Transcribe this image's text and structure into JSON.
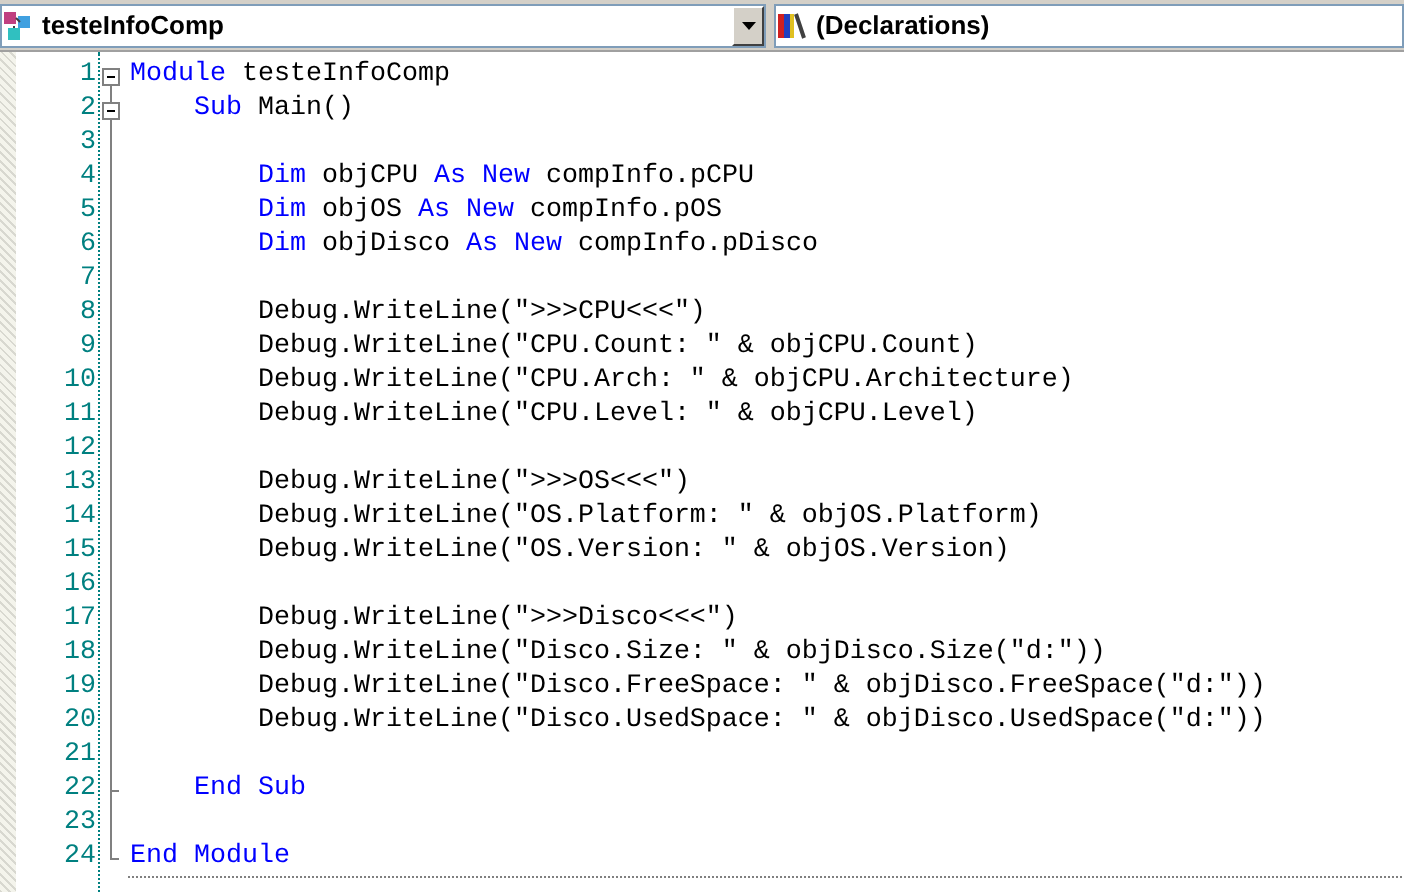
{
  "class_dropdown": {
    "value": "testeInfoComp"
  },
  "method_dropdown": {
    "value": "(Declarations)"
  },
  "editor": {
    "lines": [
      {
        "number": "1",
        "collapsible": true,
        "block_end": false,
        "tokens": [
          {
            "kind": "keyword",
            "text": "Module"
          },
          {
            "kind": "text",
            "text": " testeInfoComp"
          }
        ]
      },
      {
        "number": "2",
        "collapsible": true,
        "block_end": false,
        "tokens": [
          {
            "kind": "keyword",
            "text": "    Sub"
          },
          {
            "kind": "text",
            "text": " Main()"
          }
        ]
      },
      {
        "number": "3",
        "collapsible": false,
        "block_end": false
      },
      {
        "number": "4",
        "collapsible": false,
        "block_end": false,
        "tokens": [
          {
            "kind": "keyword",
            "text": "        Dim"
          },
          {
            "kind": "text",
            "text": " objCPU "
          },
          {
            "kind": "keyword",
            "text": "As New"
          },
          {
            "kind": "text",
            "text": " compInfo.pCPU"
          }
        ]
      },
      {
        "number": "5",
        "collapsible": false,
        "block_end": false,
        "tokens": [
          {
            "kind": "keyword",
            "text": "        Dim"
          },
          {
            "kind": "text",
            "text": " objOS "
          },
          {
            "kind": "keyword",
            "text": "As New"
          },
          {
            "kind": "text",
            "text": " compInfo.pOS"
          }
        ]
      },
      {
        "number": "6",
        "collapsible": false,
        "block_end": false,
        "tokens": [
          {
            "kind": "keyword",
            "text": "        Dim"
          },
          {
            "kind": "text",
            "text": " objDisco "
          },
          {
            "kind": "keyword",
            "text": "As New"
          },
          {
            "kind": "text",
            "text": " compInfo.pDisco"
          }
        ]
      },
      {
        "number": "7",
        "collapsible": false,
        "block_end": false
      },
      {
        "number": "8",
        "collapsible": false,
        "block_end": false,
        "tokens": [
          {
            "kind": "text",
            "text": "        Debug.WriteLine(\">>>CPU<<<\")"
          }
        ]
      },
      {
        "number": "9",
        "collapsible": false,
        "block_end": false,
        "tokens": [
          {
            "kind": "text",
            "text": "        Debug.WriteLine(\"CPU.Count: \" & objCPU.Count)"
          }
        ]
      },
      {
        "number": "10",
        "collapsible": false,
        "block_end": false,
        "tokens": [
          {
            "kind": "text",
            "text": "        Debug.WriteLine(\"CPU.Arch: \" & objCPU.Architecture)"
          }
        ]
      },
      {
        "number": "11",
        "collapsible": false,
        "block_end": false,
        "tokens": [
          {
            "kind": "text",
            "text": "        Debug.WriteLine(\"CPU.Level: \" & objCPU.Level)"
          }
        ]
      },
      {
        "number": "12",
        "collapsible": false,
        "block_end": false
      },
      {
        "number": "13",
        "collapsible": false,
        "block_end": false,
        "tokens": [
          {
            "kind": "text",
            "text": "        Debug.WriteLine(\">>>OS<<<\")"
          }
        ]
      },
      {
        "number": "14",
        "collapsible": false,
        "block_end": false,
        "tokens": [
          {
            "kind": "text",
            "text": "        Debug.WriteLine(\"OS.Platform: \" & objOS.Platform)"
          }
        ]
      },
      {
        "number": "15",
        "collapsible": false,
        "block_end": false,
        "tokens": [
          {
            "kind": "text",
            "text": "        Debug.WriteLine(\"OS.Version: \" & objOS.Version)"
          }
        ]
      },
      {
        "number": "16",
        "collapsible": false,
        "block_end": false
      },
      {
        "number": "17",
        "collapsible": false,
        "block_end": false,
        "tokens": [
          {
            "kind": "text",
            "text": "        Debug.WriteLine(\">>>Disco<<<\")"
          }
        ]
      },
      {
        "number": "18",
        "collapsible": false,
        "block_end": false,
        "tokens": [
          {
            "kind": "text",
            "text": "        Debug.WriteLine(\"Disco.Size: \" & objDisco.Size(\"d:\"))"
          }
        ]
      },
      {
        "number": "19",
        "collapsible": false,
        "block_end": false,
        "tokens": [
          {
            "kind": "text",
            "text": "        Debug.WriteLine(\"Disco.FreeSpace: \" & objDisco.FreeSpace(\"d:\"))"
          }
        ]
      },
      {
        "number": "20",
        "collapsible": false,
        "block_end": false,
        "tokens": [
          {
            "kind": "text",
            "text": "        Debug.WriteLine(\"Disco.UsedSpace: \" & objDisco.UsedSpace(\"d:\"))"
          }
        ]
      },
      {
        "number": "21",
        "collapsible": false,
        "block_end": false
      },
      {
        "number": "22",
        "collapsible": false,
        "block_end": true,
        "tokens": [
          {
            "kind": "keyword",
            "text": "    End Sub"
          }
        ]
      },
      {
        "number": "23",
        "collapsible": false,
        "block_end": false
      },
      {
        "number": "24",
        "collapsible": false,
        "block_end": true,
        "tokens": [
          {
            "kind": "keyword",
            "text": "End Module"
          }
        ]
      }
    ]
  }
}
